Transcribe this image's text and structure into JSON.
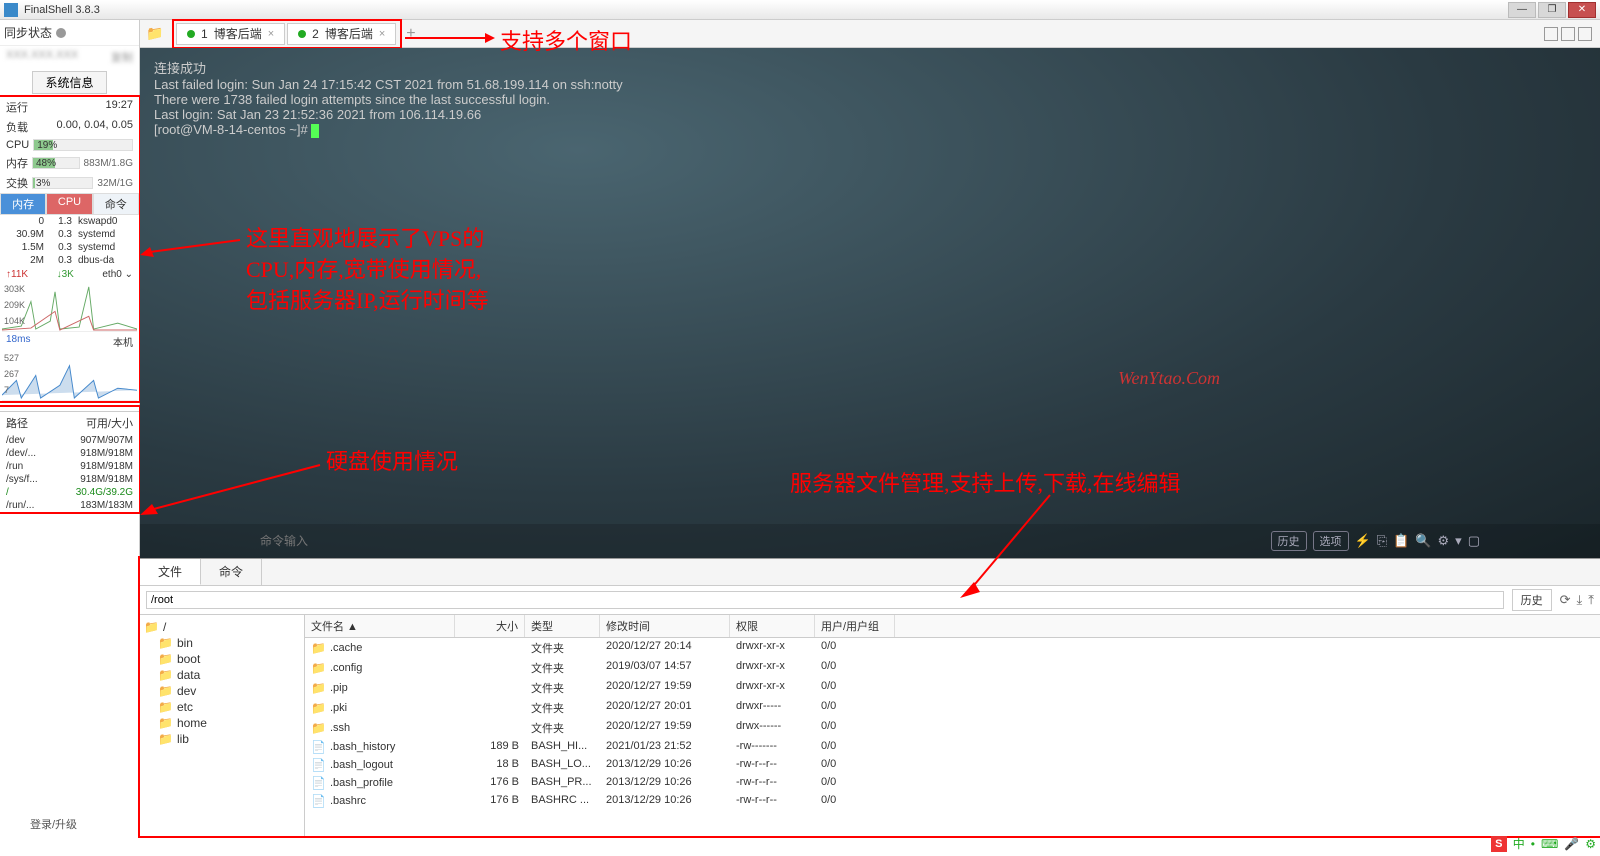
{
  "app": {
    "title": "FinalShell 3.8.3"
  },
  "window_buttons": {
    "min": "—",
    "max": "❐",
    "close": "✕"
  },
  "sidebar": {
    "sync_label": "同步状态",
    "copy": "复制",
    "sys_btn": "系统信息",
    "run_label": "运行",
    "run_val": "19:27",
    "load_label": "负载",
    "load_val": "0.00, 0.04, 0.05",
    "cpu_label": "CPU",
    "cpu_pct": "19%",
    "cpu_fill": 19,
    "mem_label": "内存",
    "mem_pct": "48%",
    "mem_txt": "883M/1.8G",
    "mem_fill": 48,
    "swap_label": "交换",
    "swap_pct": "3%",
    "swap_txt": "32M/1G",
    "swap_fill": 3,
    "proc_tabs": {
      "mem": "内存",
      "cpu": "CPU",
      "cmd": "命令"
    },
    "procs": [
      {
        "m": "0",
        "c": "1.3",
        "n": "kswapd0"
      },
      {
        "m": "30.9M",
        "c": "0.3",
        "n": "systemd"
      },
      {
        "m": "1.5M",
        "c": "0.3",
        "n": "systemd"
      },
      {
        "m": "2M",
        "c": "0.3",
        "n": "dbus-da"
      }
    ],
    "net": {
      "up": "↑11K",
      "dn": "↓3K",
      "if": "eth0 ⌄",
      "y1": "303K",
      "y2": "209K",
      "y3": "104K"
    },
    "ping": {
      "lat": "18ms",
      "host": "本机",
      "y1": "527",
      "y2": "267",
      "y3": "7"
    },
    "disk_head": {
      "path": "路径",
      "avail": "可用/大小"
    },
    "disks": [
      {
        "p": "/dev",
        "s": "907M/907M"
      },
      {
        "p": "/dev/...",
        "s": "918M/918M"
      },
      {
        "p": "/run",
        "s": "918M/918M"
      },
      {
        "p": "/sys/f...",
        "s": "918M/918M"
      },
      {
        "p": "/",
        "s": "30.4G/39.2G"
      },
      {
        "p": "/run/...",
        "s": "183M/183M"
      }
    ],
    "login": "登录/升级"
  },
  "tabs": [
    {
      "idx": "1",
      "name": "博客后端"
    },
    {
      "idx": "2",
      "name": "博客后端"
    }
  ],
  "terminal": {
    "lines": [
      "连接成功",
      "Last failed login: Sun Jan 24 17:15:42 CST 2021 from 51.68.199.114 on ssh:notty",
      "There were 1738 failed login attempts since the last successful login.",
      "Last login: Sat Jan 23 21:52:36 2021 from 106.114.19.66"
    ],
    "prompt": "[root@VM-8-14-centos ~]# "
  },
  "watermark": "WenYtao.Com",
  "cmdbar": {
    "placeholder": "命令输入",
    "hist": "历史",
    "opts": "选项"
  },
  "annotations": {
    "multi": "支持多个窗口",
    "vps": "这里直观地展示了VPS的\nCPU,内存,宽带使用情况,\n包括服务器IP,运行时间等",
    "disk": "硬盘使用情况",
    "file": "服务器文件管理,支持上传,下载,在线编辑"
  },
  "fm": {
    "tab_file": "文件",
    "tab_cmd": "命令",
    "path": "/root",
    "hist": "历史",
    "tree": [
      "/",
      "bin",
      "boot",
      "data",
      "dev",
      "etc",
      "home",
      "lib"
    ],
    "cols": {
      "name": "文件名 ▲",
      "size": "大小",
      "type": "类型",
      "time": "修改时间",
      "perm": "权限",
      "user": "用户/用户组"
    },
    "rows": [
      {
        "n": ".cache",
        "s": "",
        "t": "文件夹",
        "tm": "2020/12/27 20:14",
        "p": "drwxr-xr-x",
        "u": "0/0",
        "f": true
      },
      {
        "n": ".config",
        "s": "",
        "t": "文件夹",
        "tm": "2019/03/07 14:57",
        "p": "drwxr-xr-x",
        "u": "0/0",
        "f": true
      },
      {
        "n": ".pip",
        "s": "",
        "t": "文件夹",
        "tm": "2020/12/27 19:59",
        "p": "drwxr-xr-x",
        "u": "0/0",
        "f": true
      },
      {
        "n": ".pki",
        "s": "",
        "t": "文件夹",
        "tm": "2020/12/27 20:01",
        "p": "drwxr-----",
        "u": "0/0",
        "f": true
      },
      {
        "n": ".ssh",
        "s": "",
        "t": "文件夹",
        "tm": "2020/12/27 19:59",
        "p": "drwx------",
        "u": "0/0",
        "f": true
      },
      {
        "n": ".bash_history",
        "s": "189 B",
        "t": "BASH_HI...",
        "tm": "2021/01/23 21:52",
        "p": "-rw-------",
        "u": "0/0",
        "f": false
      },
      {
        "n": ".bash_logout",
        "s": "18 B",
        "t": "BASH_LO...",
        "tm": "2013/12/29 10:26",
        "p": "-rw-r--r--",
        "u": "0/0",
        "f": false
      },
      {
        "n": ".bash_profile",
        "s": "176 B",
        "t": "BASH_PR...",
        "tm": "2013/12/29 10:26",
        "p": "-rw-r--r--",
        "u": "0/0",
        "f": false
      },
      {
        "n": ".bashrc",
        "s": "176 B",
        "t": "BASHRC ...",
        "tm": "2013/12/29 10:26",
        "p": "-rw-r--r--",
        "u": "0/0",
        "f": false
      }
    ]
  },
  "tray": {
    "s": "S",
    "cn": "中"
  }
}
